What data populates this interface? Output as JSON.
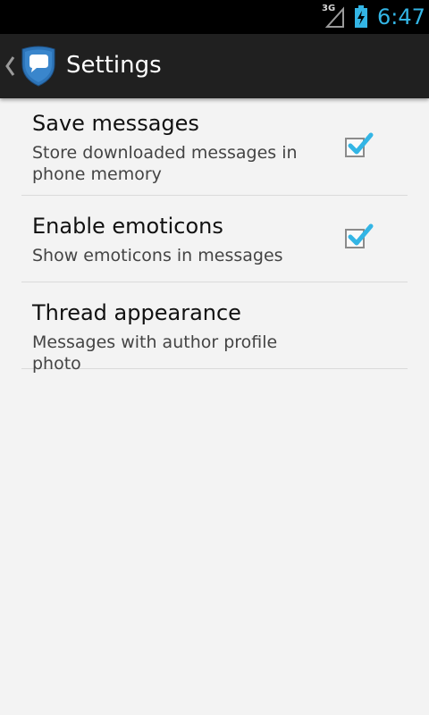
{
  "status_bar": {
    "network": "3G",
    "time": "6:47",
    "icons": [
      "signal-icon",
      "battery-charging-icon"
    ]
  },
  "action_bar": {
    "title": "Settings",
    "icons": [
      "back-chevron-icon",
      "app-logo-icon"
    ]
  },
  "preferences": [
    {
      "title": "Save messages",
      "summary": "Store downloaded messages in phone memory",
      "checked": true
    },
    {
      "title": "Enable emoticons",
      "summary": "Show emoticons in messages",
      "checked": true
    },
    {
      "title": "Thread appearance",
      "summary": "Messages with author profile photo"
    }
  ],
  "colors": {
    "accent": "#33b5e5",
    "action_bar": "#202020",
    "background": "#f3f3f3",
    "logo_blue": "#2d74b8"
  }
}
